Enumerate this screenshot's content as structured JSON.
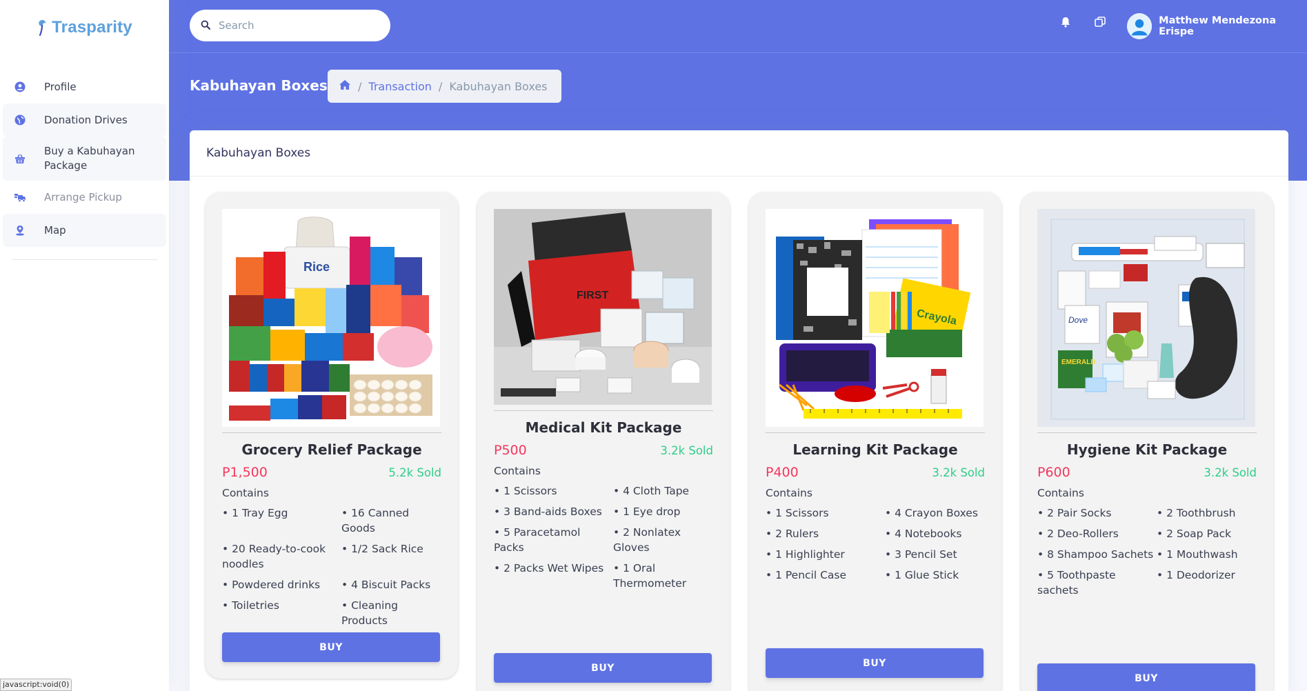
{
  "brand": {
    "name": "Trasparity"
  },
  "sidebar": {
    "items": [
      {
        "label": "Profile",
        "icon": "profile-icon"
      },
      {
        "label": "Donation Drives",
        "icon": "globe-icon"
      },
      {
        "label": "Buy a Kabuhayan Package",
        "icon": "basket-icon"
      },
      {
        "label": "Arrange Pickup",
        "icon": "truck-icon"
      },
      {
        "label": "Map",
        "icon": "map-pin-icon"
      }
    ]
  },
  "header": {
    "search_placeholder": "Search",
    "user_name": "Matthew Mendezona Erispe"
  },
  "page": {
    "title": "Kabuhayan Boxes",
    "breadcrumb": {
      "link": "Transaction",
      "current": "Kabuhayan Boxes",
      "separator": "/"
    },
    "panel_title": "Kabuhayan Boxes"
  },
  "products": [
    {
      "name": "Grocery Relief Package",
      "price": "P1,500",
      "sold": "5.2k Sold",
      "contains_label": "Contains",
      "items": [
        "• 1 Tray Egg",
        "• 16 Canned Goods",
        "• 20 Ready-to-cook noodles",
        "• 1/2 Sack Rice",
        "• Powdered drinks",
        "• 4 Biscuit Packs",
        "• Toiletries",
        "• Cleaning Products"
      ],
      "buy_label": "BUY"
    },
    {
      "name": "Medical Kit Package",
      "price": "P500",
      "sold": "3.2k Sold",
      "contains_label": "Contains",
      "items": [
        "• 1 Scissors",
        "• 4 Cloth Tape",
        "• 3 Band-aids Boxes",
        "• 1 Eye drop",
        "• 5 Paracetamol Packs",
        "• 2 Nonlatex Gloves",
        "• 2 Packs Wet Wipes",
        "• 1 Oral Thermometer"
      ],
      "buy_label": "BUY"
    },
    {
      "name": "Learning Kit Package",
      "price": "P400",
      "sold": "3.2k Sold",
      "contains_label": "Contains",
      "items": [
        "• 1 Scissors",
        "• 4 Crayon Boxes",
        "• 2 Rulers",
        "• 4 Notebooks",
        "• 1 Highlighter",
        "• 3 Pencil Set",
        "• 1 Pencil Case",
        "• 1 Glue Stick"
      ],
      "buy_label": "BUY"
    },
    {
      "name": "Hygiene Kit Package",
      "price": "P600",
      "sold": "3.2k Sold",
      "contains_label": "Contains",
      "items": [
        "• 2 Pair Socks",
        "• 2 Toothbrush",
        "• 2 Deo-Rollers",
        "• 2 Soap Pack",
        "• 8 Shampoo Sachets",
        "• 1 Mouthwash",
        "• 5 Toothpaste sachets",
        "• 1 Deodorizer"
      ],
      "buy_label": "BUY"
    }
  ],
  "status_bar": {
    "text": "javascript:void(0)"
  },
  "colors": {
    "primary": "#5e72e4",
    "price": "#f5365c",
    "sold": "#2dce89",
    "brand": "#5ea0dc"
  }
}
